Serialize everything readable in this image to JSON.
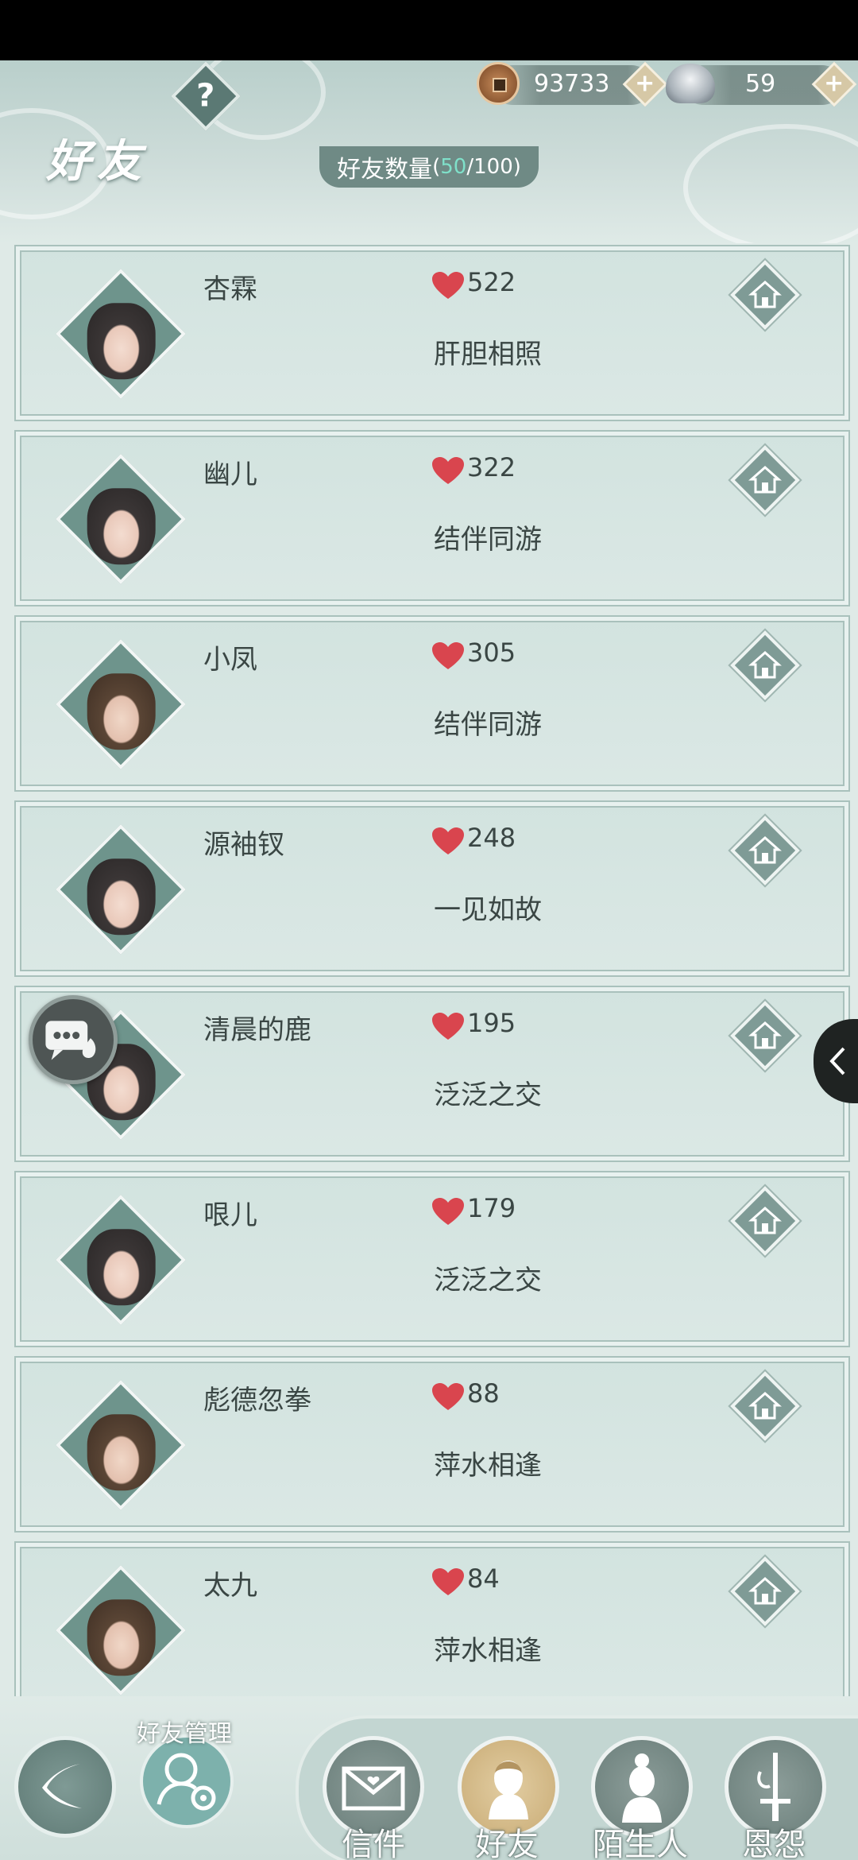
{
  "header": {
    "title": "好友",
    "help_label": "?",
    "currency": {
      "coins": "93733",
      "silver": "59"
    },
    "friend_count": {
      "label": "好友数量",
      "current": "50",
      "max": "/100"
    }
  },
  "friends": [
    {
      "name": "杏霖",
      "affinity": "522",
      "relation": "肝胆相照"
    },
    {
      "name": "幽儿",
      "affinity": "322",
      "relation": "结伴同游"
    },
    {
      "name": "小凤",
      "affinity": "305",
      "relation": "结伴同游"
    },
    {
      "name": "源袖钗",
      "affinity": "248",
      "relation": "一见如故"
    },
    {
      "name": "清晨的鹿",
      "affinity": "195",
      "relation": "泛泛之交"
    },
    {
      "name": "哏儿",
      "affinity": "179",
      "relation": "泛泛之交"
    },
    {
      "name": "彪德忽拳",
      "affinity": "88",
      "relation": "萍水相逢"
    },
    {
      "name": "太九",
      "affinity": "84",
      "relation": "萍水相逢"
    }
  ],
  "bottom_nav": {
    "manage_label": "好友管理",
    "tabs": [
      {
        "label": "信件"
      },
      {
        "label": "好友"
      },
      {
        "label": "陌生人"
      },
      {
        "label": "恩怨"
      }
    ],
    "active_tab": "好友"
  },
  "colors": {
    "background": "#dfeae7",
    "card": "#d6e6e2",
    "heart": "#d9454e",
    "accent_teal": "#6f8a85",
    "count_highlight": "#7fe0c9"
  }
}
